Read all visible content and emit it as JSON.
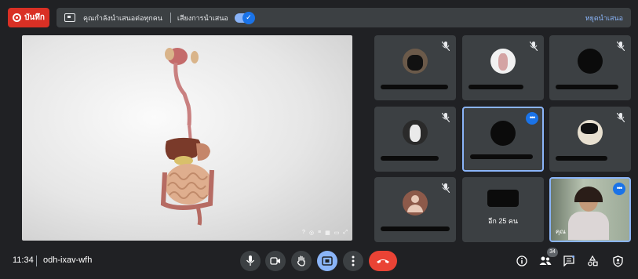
{
  "top_bar": {
    "record_label": "บันทึก",
    "presenting_text": "คุณกำลังนำเสนอต่อทุกคน",
    "audio_label": "เสียงการนำเสนอ",
    "stop_presenting_label": "หยุดนำเสนอ"
  },
  "participants": {
    "others_label": "อีก 25 คน",
    "self_label": "คุณ"
  },
  "bottom_bar": {
    "time": "11:34",
    "meeting_code": "odh-ixav-wfh",
    "participants_count": "34"
  },
  "colors": {
    "background": "#202124",
    "tile": "#3c4043",
    "accent": "#8ab4f8",
    "record": "#d93025",
    "end_call": "#ea4335"
  },
  "icons": {
    "mic": "mic-icon",
    "camera": "camera-icon",
    "hand": "raise-hand-icon",
    "present": "present-screen-icon",
    "more": "more-vert-icon",
    "end": "call-end-icon",
    "info": "info-icon",
    "people": "people-icon",
    "chat": "chat-icon",
    "activities": "activities-icon",
    "host": "host-controls-icon"
  }
}
